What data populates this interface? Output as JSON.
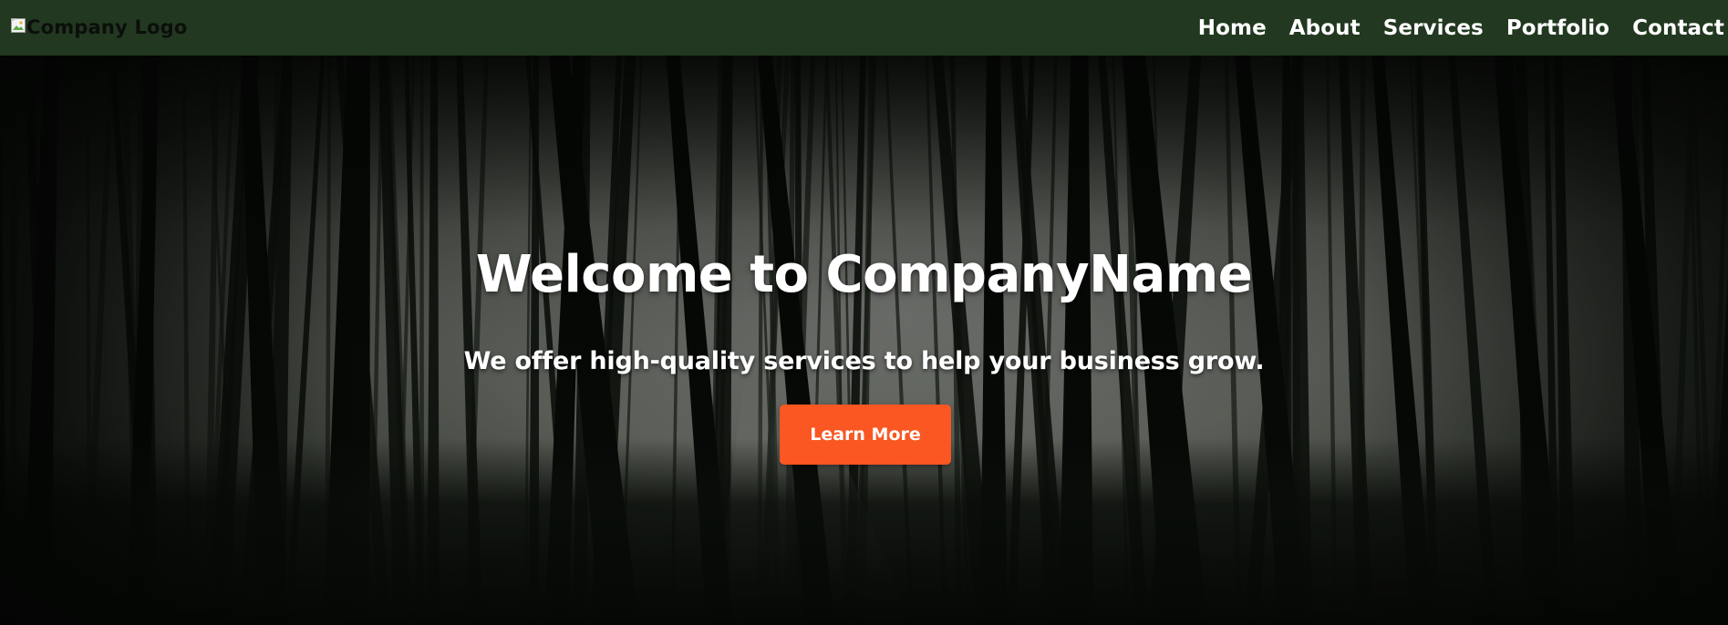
{
  "navbar": {
    "logo_alt": "Company Logo",
    "links": [
      {
        "label": "Home"
      },
      {
        "label": "About"
      },
      {
        "label": "Services"
      },
      {
        "label": "Portfolio"
      },
      {
        "label": "Contact"
      }
    ],
    "background_color": "#223820"
  },
  "hero": {
    "title": "Welcome to CompanyName",
    "subtitle": "We offer high-quality services to help your business grow.",
    "cta_label": "Learn More",
    "cta_color": "#fa5722",
    "background_image": "forest-trees"
  },
  "icons": {
    "logo": "broken-image-icon"
  }
}
